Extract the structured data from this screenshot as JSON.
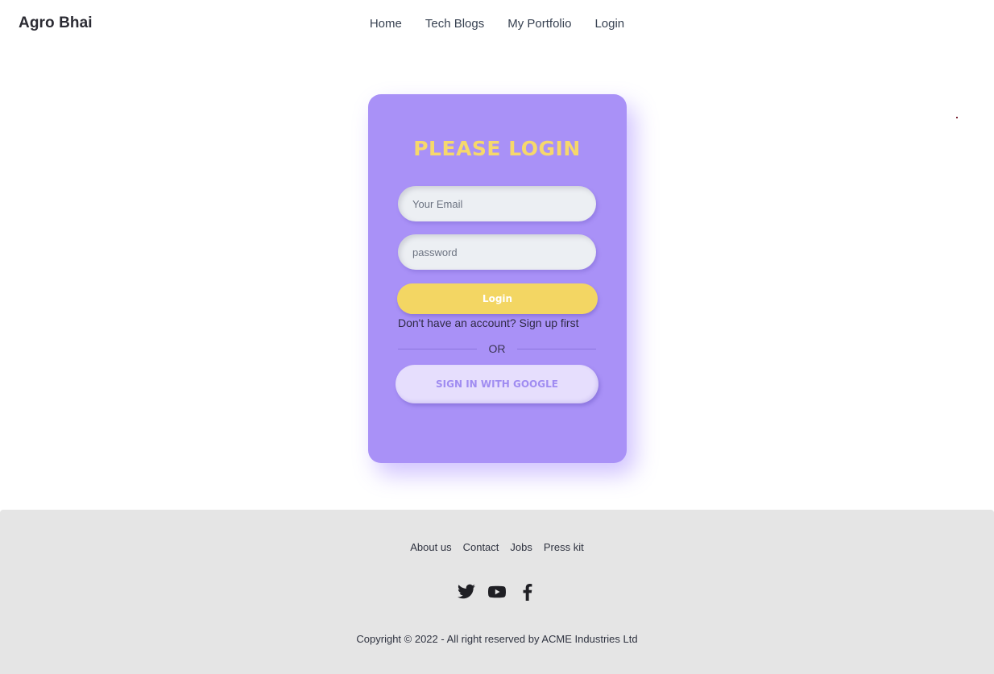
{
  "navbar": {
    "brand": "Agro Bhai",
    "links": [
      "Home",
      "Tech Blogs",
      "My Portfolio",
      "Login"
    ]
  },
  "login_card": {
    "title": "PLEASE LOGIN",
    "email_placeholder": "Your Email",
    "password_placeholder": "password",
    "login_button": "Login",
    "signup_text": "Don't have an account? Sign up first",
    "divider_text": "OR",
    "google_button": "SIGN IN WITH GOOGLE"
  },
  "footer": {
    "links": [
      "About us",
      "Contact",
      "Jobs",
      "Press kit"
    ],
    "socials": [
      "twitter-icon",
      "youtube-icon",
      "facebook-icon"
    ],
    "copyright": "Copyright © 2022 - All right reserved by ACME Industries Ltd"
  },
  "colors": {
    "card": "#a991f7",
    "title": "#f6d86b",
    "login_button": "#f3d663",
    "google_button": "#e6defd",
    "footer": "#e5e5e5"
  }
}
